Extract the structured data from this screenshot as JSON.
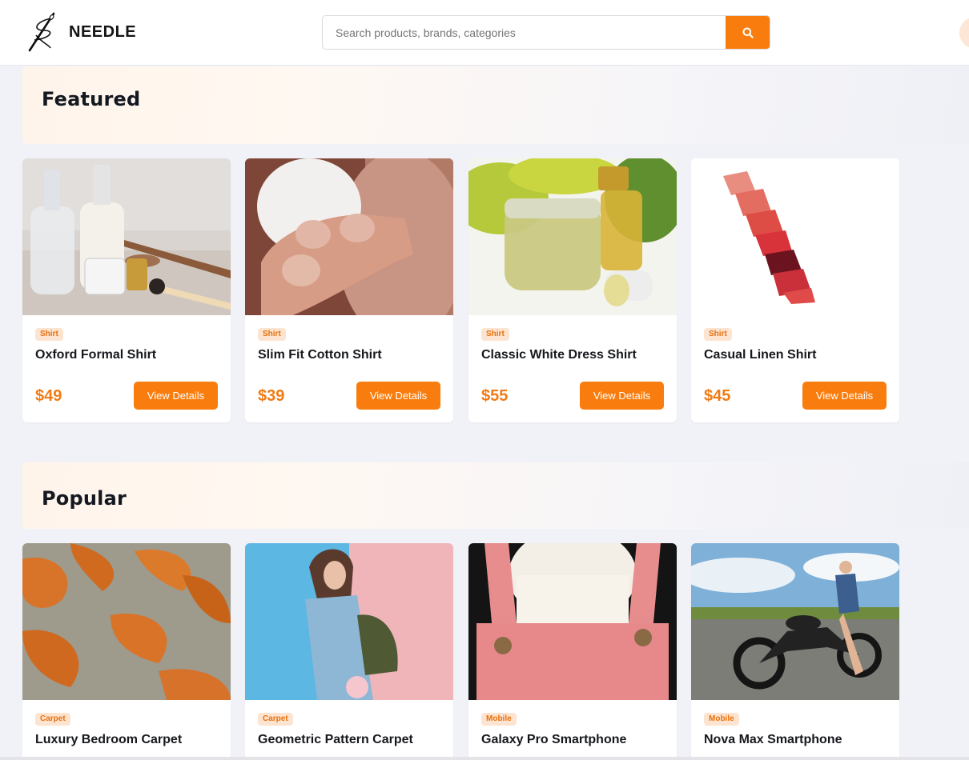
{
  "header": {
    "logo_text": "NEEDLE",
    "search_placeholder": "Search products, brands, categories",
    "search_value": ""
  },
  "sections": [
    {
      "title": "Featured",
      "products": [
        {
          "category": "Shirt",
          "name": "Oxford Formal Shirt",
          "price": "$49",
          "button": "View Details",
          "image": "cosmetic-bottles-photo"
        },
        {
          "category": "Shirt",
          "name": "Slim Fit Cotton Shirt",
          "price": "$39",
          "button": "View Details",
          "image": "cotton-pad-fingers-photo"
        },
        {
          "category": "Shirt",
          "name": "Classic White Dress Shirt",
          "price": "$55",
          "button": "View Details",
          "image": "balm-jar-oil-photo"
        },
        {
          "category": "Shirt",
          "name": "Casual Linen Shirt",
          "price": "$45",
          "button": "View Details",
          "image": "lipstick-swatches-photo"
        }
      ]
    },
    {
      "title": "Popular",
      "products": [
        {
          "category": "Carpet",
          "name": "Luxury Bedroom Carpet",
          "image": "embroidered-carpet-photo"
        },
        {
          "category": "Carpet",
          "name": "Geometric Pattern Carpet",
          "image": "woman-backpack-photo"
        },
        {
          "category": "Mobile",
          "name": "Galaxy Pro Smartphone",
          "image": "pink-overalls-photo"
        },
        {
          "category": "Mobile",
          "name": "Nova Max Smartphone",
          "image": "woman-motorcycle-photo"
        }
      ]
    }
  ],
  "colors": {
    "accent": "#f97d0e",
    "price": "#f07b14",
    "badge_bg": "#fde4d1",
    "badge_text": "#e8700c",
    "page_bg": "#f1f2f7"
  },
  "icons": {
    "logo": "needle-thread-icon",
    "search": "search-icon"
  }
}
